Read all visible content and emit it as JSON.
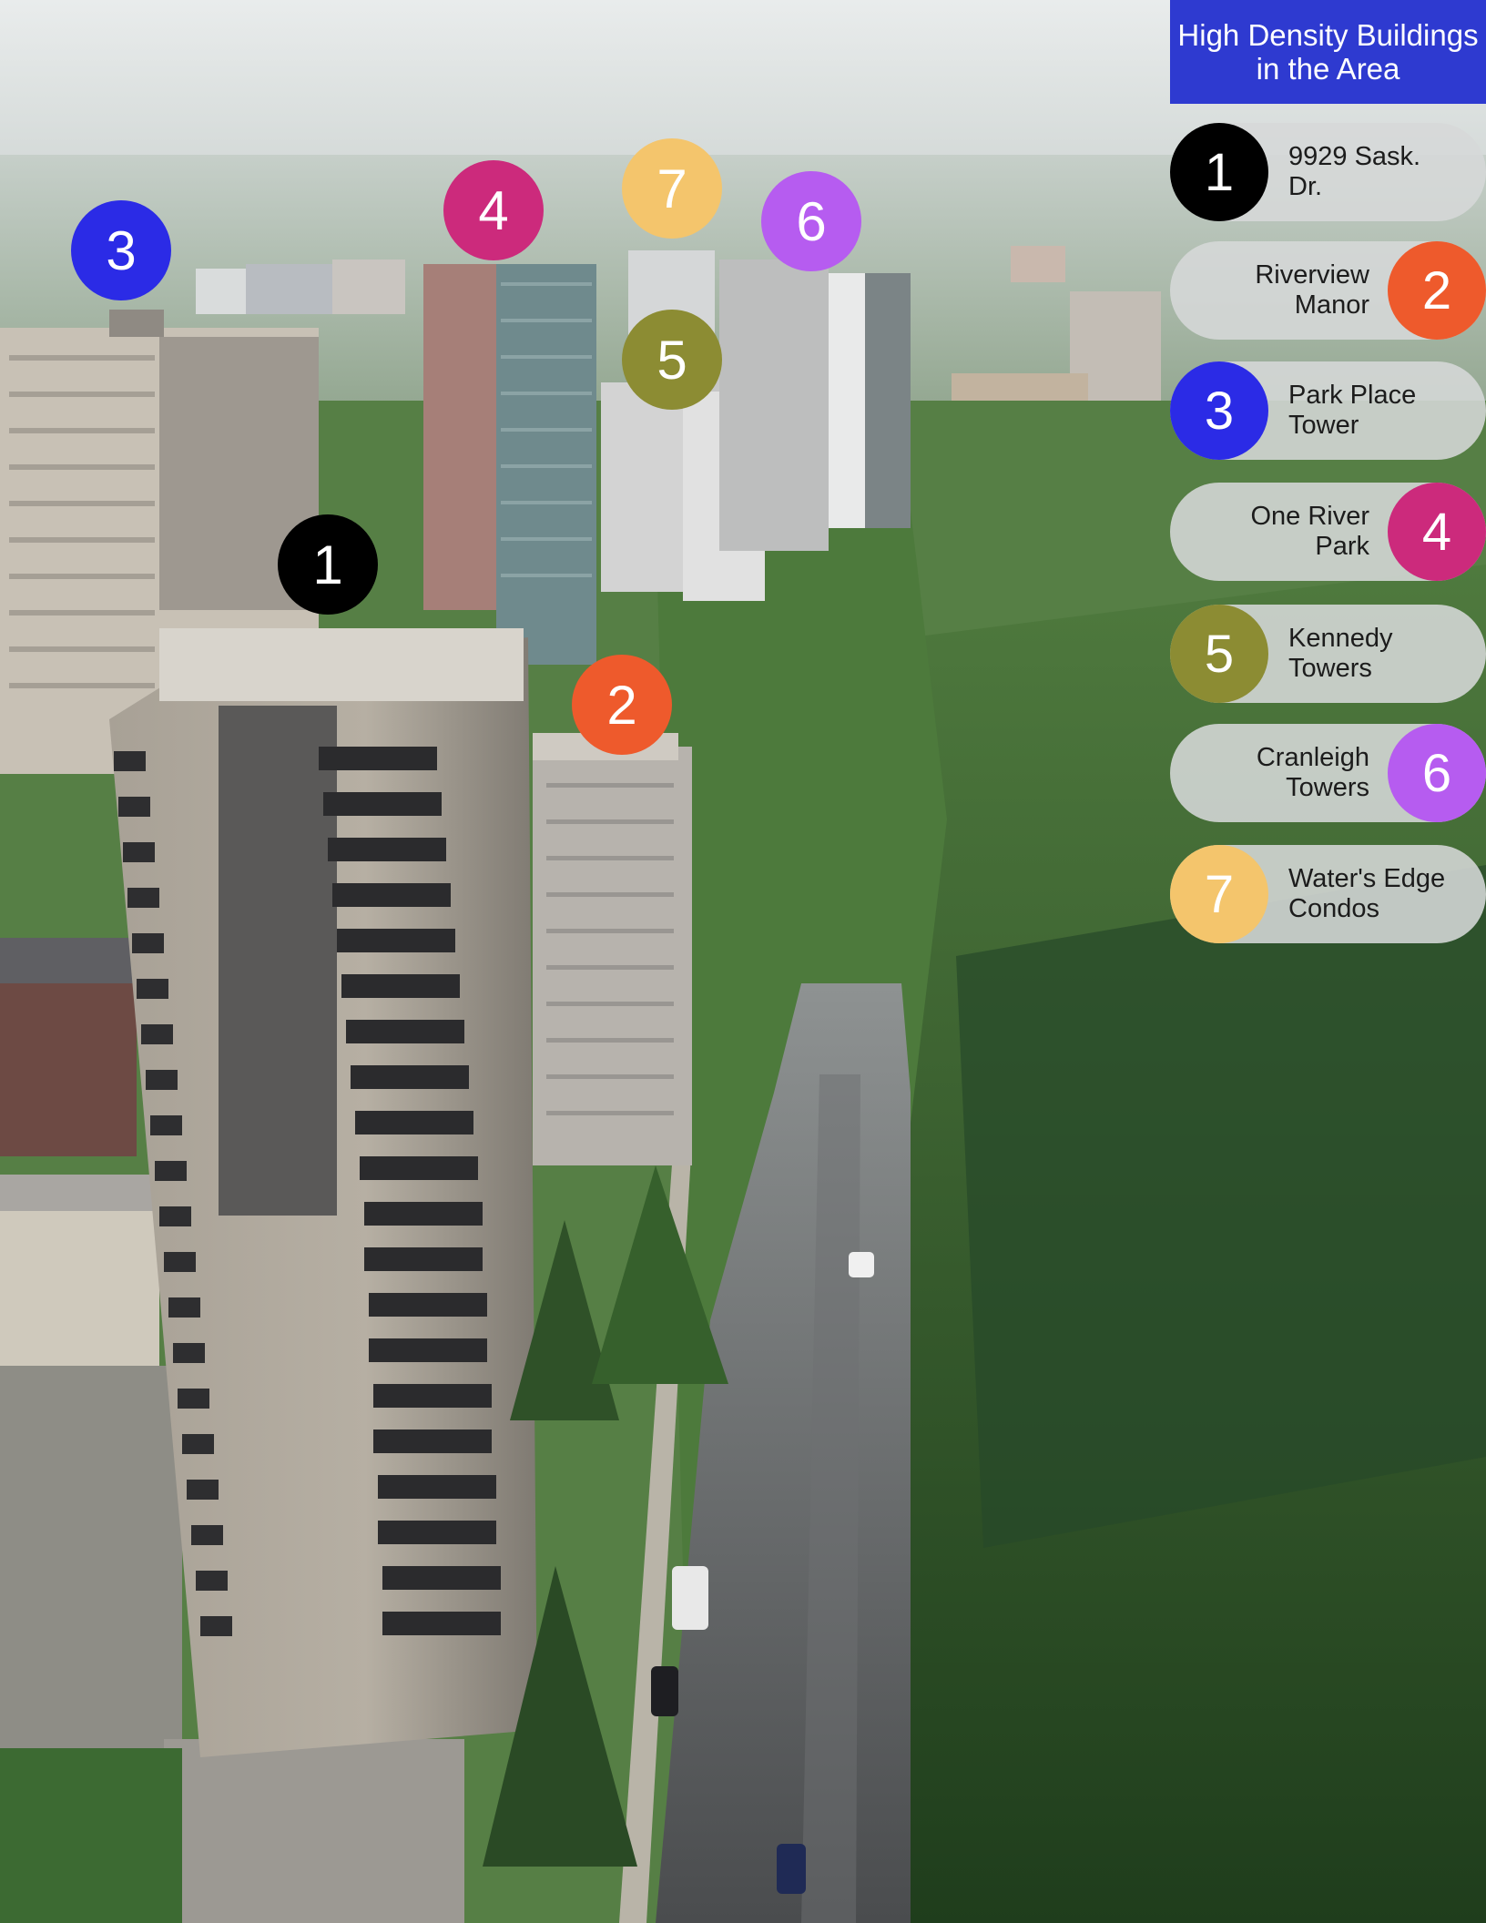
{
  "legend": {
    "title": "High Density Buildings in the Area",
    "items": [
      {
        "number": "1",
        "name": "9929 Sask. Dr.",
        "color": "#000000"
      },
      {
        "number": "2",
        "name": "Riverview Manor",
        "color": "#ee5a2c"
      },
      {
        "number": "3",
        "name": "Park Place Tower",
        "color": "#2b2be6"
      },
      {
        "number": "4",
        "name": "One River Park",
        "color": "#cc2a7c"
      },
      {
        "number": "5",
        "name": "Kennedy Towers",
        "color": "#8c8c33"
      },
      {
        "number": "6",
        "name": "Cranleigh Towers",
        "color": "#b65cf0"
      },
      {
        "number": "7",
        "name": "Water's Edge Condos",
        "color": "#f4c56c"
      }
    ]
  },
  "markers": [
    {
      "number": "1",
      "color": "#000000"
    },
    {
      "number": "2",
      "color": "#ee5a2c"
    },
    {
      "number": "3",
      "color": "#2b2be6"
    },
    {
      "number": "4",
      "color": "#cc2a7c"
    },
    {
      "number": "5",
      "color": "#8c8c33"
    },
    {
      "number": "6",
      "color": "#b65cf0"
    },
    {
      "number": "7",
      "color": "#f4c56c"
    }
  ]
}
